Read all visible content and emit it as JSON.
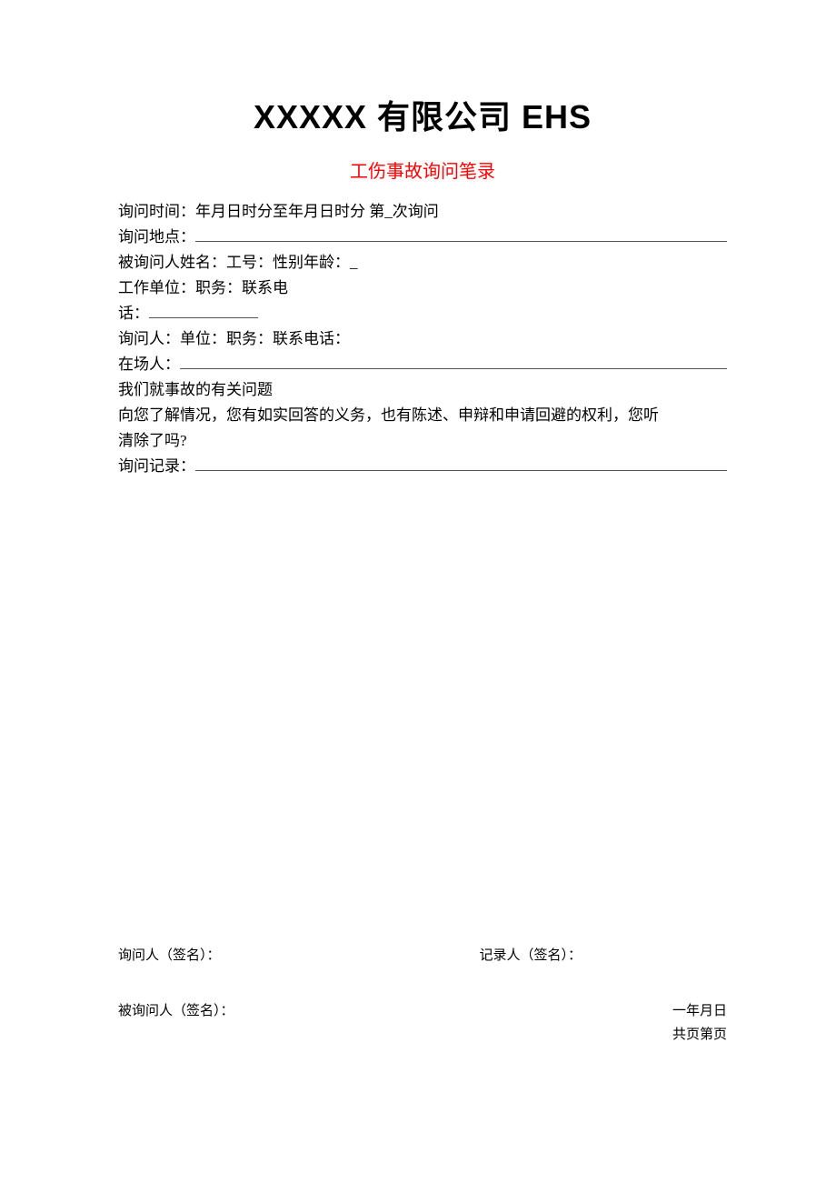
{
  "header": {
    "company_title": "XXXXX 有限公司 EHS",
    "form_title": "工伤事故询问笔录"
  },
  "body": {
    "line1": "询问时间：年月日时分至年月日时分 第_次询问",
    "line2_prefix": "询问地点：",
    "line3": "被询问人姓名：工号：性别年龄：_",
    "line4": "工作单位：职务：联系电",
    "line5_prefix": "话：",
    "line6": "询问人：单位：职务：联系电话：",
    "line7_prefix": "在场人：",
    "line8": "我们就事故的有关问题",
    "line9": "向您了解情况，您有如实回答的义务，也有陈述、申辩和申请回避的权利，您听",
    "line10": "清除了吗?",
    "line11_prefix": "询问记录："
  },
  "footer": {
    "interviewer_sign_label": "询问人（签名）：",
    "recorder_sign_label": "记录人（签名）：",
    "interviewee_sign_label": "被询问人（签名）：",
    "date_label": "一年月日",
    "page_label": "共页第页"
  }
}
